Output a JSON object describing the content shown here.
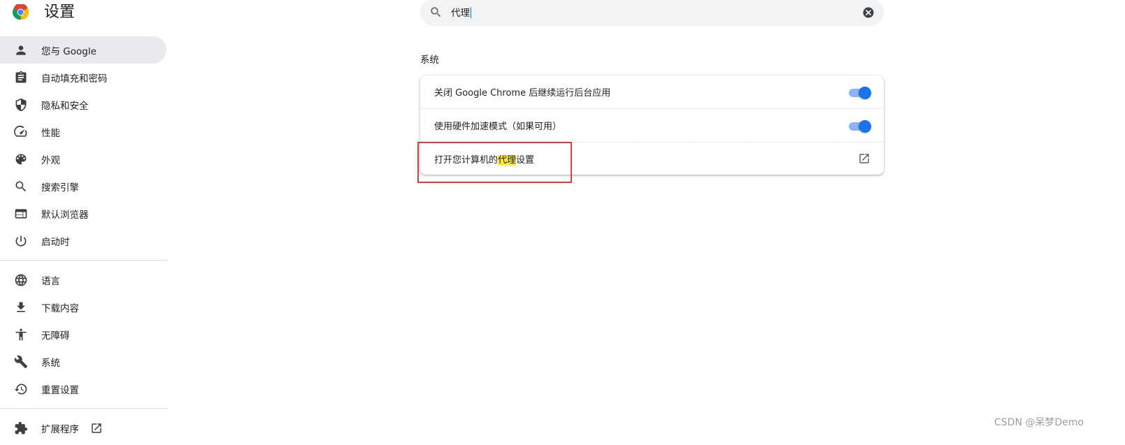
{
  "header": {
    "title": "设置"
  },
  "sidebar": {
    "items": [
      {
        "label": "您与 Google",
        "icon": "person-icon",
        "active": true
      },
      {
        "label": "自动填充和密码",
        "icon": "clipboard-icon"
      },
      {
        "label": "隐私和安全",
        "icon": "shield-icon"
      },
      {
        "label": "性能",
        "icon": "speedometer-icon"
      },
      {
        "label": "外观",
        "icon": "palette-icon"
      },
      {
        "label": "搜索引擎",
        "icon": "search-icon"
      },
      {
        "label": "默认浏览器",
        "icon": "browser-icon"
      },
      {
        "label": "启动时",
        "icon": "power-icon"
      }
    ],
    "items2": [
      {
        "label": "语言",
        "icon": "globe-icon"
      },
      {
        "label": "下载内容",
        "icon": "download-icon"
      },
      {
        "label": "无障碍",
        "icon": "accessibility-icon"
      },
      {
        "label": "系统",
        "icon": "wrench-icon"
      },
      {
        "label": "重置设置",
        "icon": "history-icon"
      }
    ],
    "extensions": {
      "label": "扩展程序",
      "icon": "puzzle-icon"
    }
  },
  "search": {
    "value": "代理"
  },
  "section": {
    "title": "系统",
    "rows": [
      {
        "label": "关闭 Google Chrome 后继续运行后台应用",
        "control": "toggle",
        "on": true
      },
      {
        "label": "使用硬件加速模式（如果可用）",
        "control": "toggle",
        "on": true
      },
      {
        "label_prefix": "打开您计算机的",
        "label_highlight": "代理",
        "label_suffix": "设置",
        "control": "open-in-new-icon"
      }
    ]
  },
  "colors": {
    "accent": "#1a73e8",
    "highlight": "#ffeb3b",
    "annotation": "#e53935"
  },
  "watermark": "CSDN @呆梦Demo"
}
